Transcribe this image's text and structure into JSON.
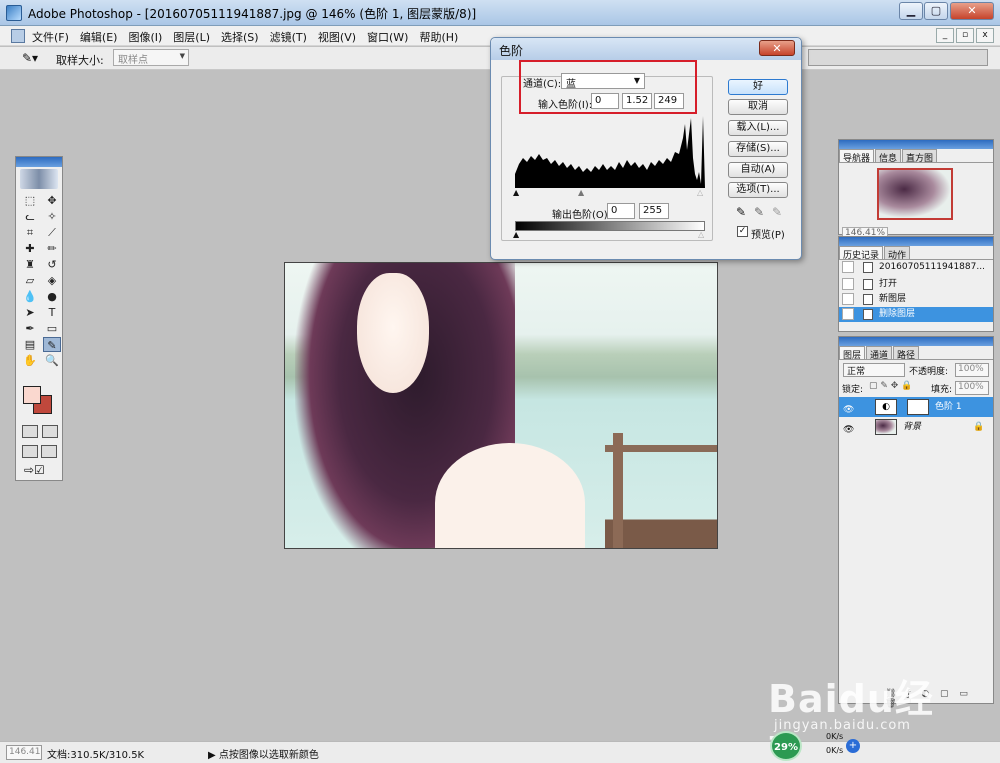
{
  "window": {
    "title": "Adobe Photoshop - [20160705111941887.jpg @ 146% (色阶 1, 图层蒙版/8)]",
    "min": "▁",
    "max": "▢",
    "close": "✕"
  },
  "menu": {
    "items": [
      "文件(F)",
      "编辑(E)",
      "图像(I)",
      "图层(L)",
      "选择(S)",
      "滤镜(T)",
      "视图(V)",
      "窗口(W)",
      "帮助(H)"
    ],
    "mdi": [
      "_",
      "▫",
      "x"
    ]
  },
  "options": {
    "sample_size_label": "取样大小:",
    "sample_size_value": "取样点"
  },
  "levels_dialog": {
    "title": "色阶",
    "close": "✕",
    "channel_label": "通道(C):",
    "channel_value": "蓝",
    "input_levels_label": "输入色阶(I):",
    "input_black": "0",
    "input_gamma": "1.52",
    "input_white": "249",
    "output_levels_label": "输出色阶(O):",
    "output_black": "0",
    "output_white": "255",
    "buttons": {
      "ok": "好",
      "cancel": "取消",
      "load": "载入(L)...",
      "save": "存储(S)...",
      "auto": "自动(A)",
      "options": "选项(T)..."
    },
    "preview_label": "预览(P)",
    "preview_checked": true
  },
  "navigator": {
    "tabs": [
      "导航器",
      "信息",
      "直方图"
    ],
    "zoom": "146.41%"
  },
  "history": {
    "tabs": [
      "历史记录",
      "动作"
    ],
    "snapshot": "20160705111941887...",
    "items": [
      "打开",
      "新图层",
      "删除图层"
    ]
  },
  "layers": {
    "tabs": [
      "图层",
      "通道",
      "路径"
    ],
    "blend_mode": "正常",
    "opacity_label": "不透明度:",
    "opacity_value": "100%",
    "lock_label": "锁定:",
    "fill_label": "填充:",
    "fill_value": "100%",
    "rows": [
      {
        "name": "色阶 1"
      },
      {
        "name": "背景"
      }
    ]
  },
  "status": {
    "zoom": "146.41",
    "doc": "文档:310.5K/310.5K",
    "hint": "点按图像以选取新颜色"
  },
  "tray": {
    "percent": "29%",
    "up": "0K/s",
    "down": "0K/s",
    "plus": "+"
  },
  "watermark": {
    "logo": "Baidu经验",
    "url": "jingyan.baidu.com"
  },
  "colors": {
    "foreground": "#fad8cf",
    "background": "#c0483c",
    "highlight_box": "#d61e2a",
    "selected_row": "#3d93e0"
  }
}
